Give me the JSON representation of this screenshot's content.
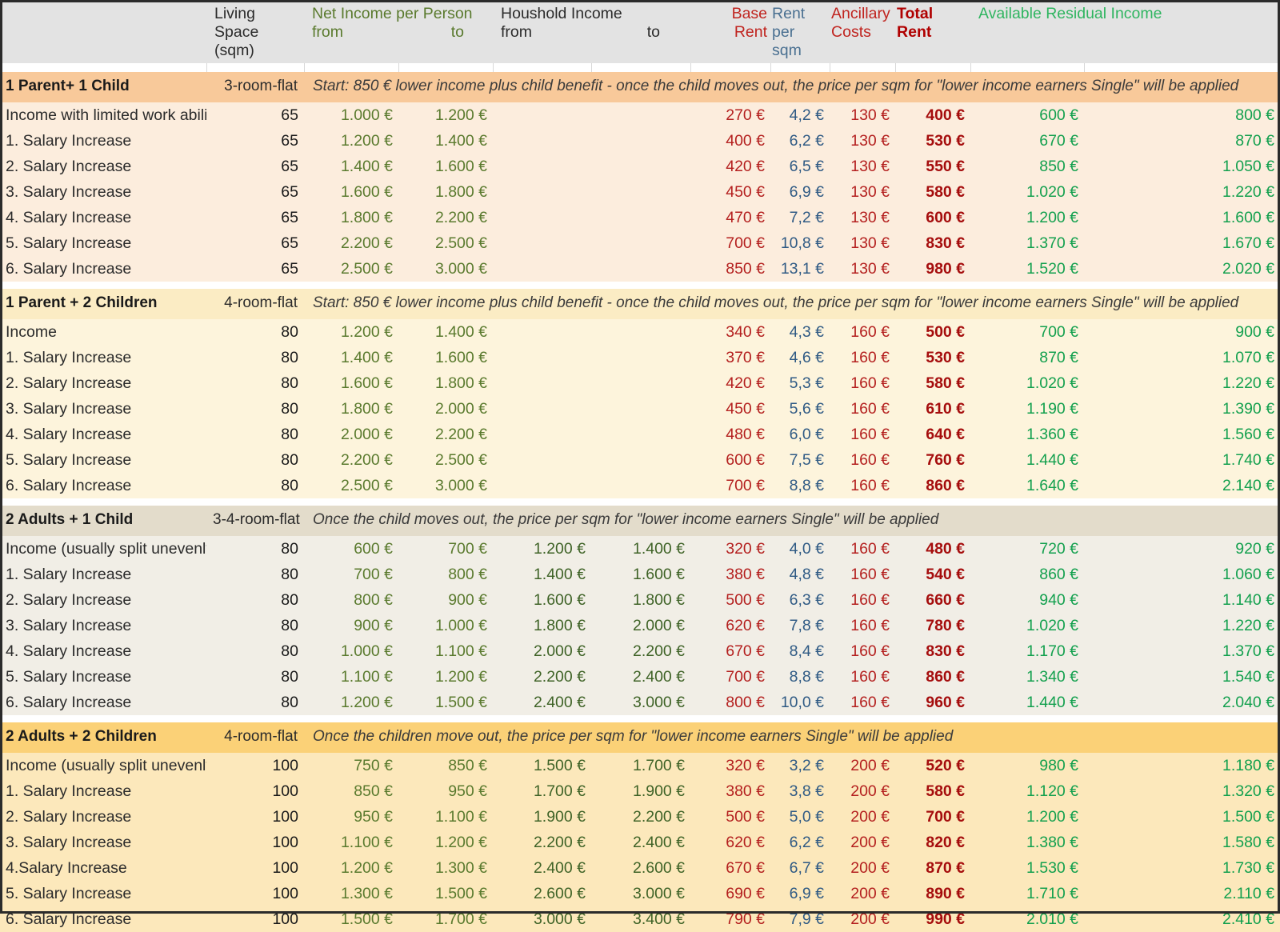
{
  "table": {
    "header": {
      "label_col": "",
      "living_space": {
        "line1": "Living Space",
        "line2": "(sqm)"
      },
      "net_income": {
        "title": "Net Income per Person",
        "from": "from",
        "to": "to"
      },
      "household_income": {
        "title": "Houshold Income",
        "from": "from",
        "to": "to"
      },
      "base_rent": "Base Rent",
      "rent_per_sqm": {
        "line1": "Rent",
        "line2": "per sqm"
      },
      "ancillary_costs": {
        "line1": "Ancillary",
        "line2": "Costs"
      },
      "total_rent": "Total Rent",
      "residual_income": "Available Residual Income"
    },
    "colors": {
      "net_income": "#5a7a2e",
      "base_rent": "#c0241f",
      "rent_per_sqm": "#4a7091",
      "ancillary": "#c0241f",
      "total_rent": "#b00000",
      "residual": "#2fb560",
      "header_bg": "#e3e3e3"
    },
    "blocks": [
      {
        "name": "1 Parent+ 1 Child",
        "flat": "3-room-flat",
        "note": "Start: 850 € lower income plus child benefit - once the child moves out, the price per sqm for \"lower income earners Single\" will be applied",
        "bg": "#fceddd",
        "header_bg": "#f8c99a",
        "rows": [
          {
            "label": "Income  with limited work ability",
            "sqm": "65",
            "net_from": "1.000 €",
            "net_to": "1.200 €",
            "hh_from": "",
            "hh_to": "",
            "base": "270 €",
            "per_sqm": "4,2 €",
            "ancillary": "130 €",
            "total": "400 €",
            "res_from": "600 €",
            "res_to": "800 €"
          },
          {
            "label": "1. Salary Increase",
            "sqm": "65",
            "net_from": "1.200 €",
            "net_to": "1.400 €",
            "hh_from": "",
            "hh_to": "",
            "base": "400 €",
            "per_sqm": "6,2 €",
            "ancillary": "130 €",
            "total": "530 €",
            "res_from": "670 €",
            "res_to": "870 €"
          },
          {
            "label": "2. Salary Increase",
            "sqm": "65",
            "net_from": "1.400 €",
            "net_to": "1.600 €",
            "hh_from": "",
            "hh_to": "",
            "base": "420 €",
            "per_sqm": "6,5 €",
            "ancillary": "130 €",
            "total": "550 €",
            "res_from": "850 €",
            "res_to": "1.050 €"
          },
          {
            "label": "3. Salary Increase",
            "sqm": "65",
            "net_from": "1.600 €",
            "net_to": "1.800 €",
            "hh_from": "",
            "hh_to": "",
            "base": "450 €",
            "per_sqm": "6,9 €",
            "ancillary": "130 €",
            "total": "580 €",
            "res_from": "1.020 €",
            "res_to": "1.220 €"
          },
          {
            "label": "4. Salary Increase",
            "sqm": "65",
            "net_from": "1.800 €",
            "net_to": "2.200 €",
            "hh_from": "",
            "hh_to": "",
            "base": "470 €",
            "per_sqm": "7,2 €",
            "ancillary": "130 €",
            "total": "600 €",
            "res_from": "1.200 €",
            "res_to": "1.600 €"
          },
          {
            "label": "5. Salary Increase",
            "sqm": "65",
            "net_from": "2.200 €",
            "net_to": "2.500 €",
            "hh_from": "",
            "hh_to": "",
            "base": "700 €",
            "per_sqm": "10,8 €",
            "ancillary": "130 €",
            "total": "830 €",
            "res_from": "1.370 €",
            "res_to": "1.670 €"
          },
          {
            "label": "6. Salary Increase",
            "sqm": "65",
            "net_from": "2.500 €",
            "net_to": "3.000 €",
            "hh_from": "",
            "hh_to": "",
            "base": "850 €",
            "per_sqm": "13,1 €",
            "ancillary": "130 €",
            "total": "980 €",
            "res_from": "1.520 €",
            "res_to": "2.020 €"
          }
        ]
      },
      {
        "name": "1 Parent + 2 Children",
        "flat": "4-room-flat",
        "note": "Start: 850 € lower income plus child benefit - once the child moves out, the price per sqm for \"lower income earners Single\" will be applied",
        "bg": "#fdf4dc",
        "header_bg": "#fbecc4",
        "rows": [
          {
            "label": "Income",
            "sqm": "80",
            "net_from": "1.200 €",
            "net_to": "1.400 €",
            "hh_from": "",
            "hh_to": "",
            "base": "340 €",
            "per_sqm": "4,3 €",
            "ancillary": "160 €",
            "total": "500 €",
            "res_from": "700 €",
            "res_to": "900 €"
          },
          {
            "label": "1. Salary Increase",
            "sqm": "80",
            "net_from": "1.400 €",
            "net_to": "1.600 €",
            "hh_from": "",
            "hh_to": "",
            "base": "370 €",
            "per_sqm": "4,6 €",
            "ancillary": "160 €",
            "total": "530 €",
            "res_from": "870 €",
            "res_to": "1.070 €"
          },
          {
            "label": "2. Salary Increase",
            "sqm": "80",
            "net_from": "1.600 €",
            "net_to": "1.800 €",
            "hh_from": "",
            "hh_to": "",
            "base": "420 €",
            "per_sqm": "5,3 €",
            "ancillary": "160 €",
            "total": "580 €",
            "res_from": "1.020 €",
            "res_to": "1.220 €"
          },
          {
            "label": "3. Salary Increase",
            "sqm": "80",
            "net_from": "1.800 €",
            "net_to": "2.000 €",
            "hh_from": "",
            "hh_to": "",
            "base": "450 €",
            "per_sqm": "5,6 €",
            "ancillary": "160 €",
            "total": "610 €",
            "res_from": "1.190 €",
            "res_to": "1.390 €"
          },
          {
            "label": "4. Salary Increase",
            "sqm": "80",
            "net_from": "2.000 €",
            "net_to": "2.200 €",
            "hh_from": "",
            "hh_to": "",
            "base": "480 €",
            "per_sqm": "6,0 €",
            "ancillary": "160 €",
            "total": "640 €",
            "res_from": "1.360 €",
            "res_to": "1.560 €"
          },
          {
            "label": "5. Salary Increase",
            "sqm": "80",
            "net_from": "2.200 €",
            "net_to": "2.500 €",
            "hh_from": "",
            "hh_to": "",
            "base": "600 €",
            "per_sqm": "7,5 €",
            "ancillary": "160 €",
            "total": "760 €",
            "res_from": "1.440 €",
            "res_to": "1.740 €"
          },
          {
            "label": "6. Salary Increase",
            "sqm": "80",
            "net_from": "2.500 €",
            "net_to": "3.000 €",
            "hh_from": "",
            "hh_to": "",
            "base": "700 €",
            "per_sqm": "8,8 €",
            "ancillary": "160 €",
            "total": "860 €",
            "res_from": "1.640 €",
            "res_to": "2.140 €"
          }
        ]
      },
      {
        "name": "2 Adults + 1 Child",
        "flat": "3-4-room-flat",
        "note": "Once the child moves out, the price per sqm for \"lower income earners Single\" will be applied",
        "bg": "#f1eee6",
        "header_bg": "#e3dccb",
        "rows": [
          {
            "label": "Income (usually split unevenly)",
            "sqm": "80",
            "net_from": "600 €",
            "net_to": "700 €",
            "hh_from": "1.200 €",
            "hh_to": "1.400 €",
            "base": "320 €",
            "per_sqm": "4,0 €",
            "ancillary": "160 €",
            "total": "480 €",
            "res_from": "720 €",
            "res_to": "920 €"
          },
          {
            "label": "1. Salary Increase",
            "sqm": "80",
            "net_from": "700 €",
            "net_to": "800 €",
            "hh_from": "1.400 €",
            "hh_to": "1.600 €",
            "base": "380 €",
            "per_sqm": "4,8 €",
            "ancillary": "160 €",
            "total": "540 €",
            "res_from": "860 €",
            "res_to": "1.060 €"
          },
          {
            "label": "2. Salary Increase",
            "sqm": "80",
            "net_from": "800 €",
            "net_to": "900 €",
            "hh_from": "1.600 €",
            "hh_to": "1.800 €",
            "base": "500 €",
            "per_sqm": "6,3 €",
            "ancillary": "160 €",
            "total": "660 €",
            "res_from": "940 €",
            "res_to": "1.140 €"
          },
          {
            "label": "3. Salary Increase",
            "sqm": "80",
            "net_from": "900 €",
            "net_to": "1.000 €",
            "hh_from": "1.800 €",
            "hh_to": "2.000 €",
            "base": "620 €",
            "per_sqm": "7,8 €",
            "ancillary": "160 €",
            "total": "780 €",
            "res_from": "1.020 €",
            "res_to": "1.220 €"
          },
          {
            "label": "4. Salary Increase",
            "sqm": "80",
            "net_from": "1.000 €",
            "net_to": "1.100 €",
            "hh_from": "2.000 €",
            "hh_to": "2.200 €",
            "base": "670 €",
            "per_sqm": "8,4 €",
            "ancillary": "160 €",
            "total": "830 €",
            "res_from": "1.170 €",
            "res_to": "1.370 €"
          },
          {
            "label": "5. Salary Increase",
            "sqm": "80",
            "net_from": "1.100 €",
            "net_to": "1.200 €",
            "hh_from": "2.200 €",
            "hh_to": "2.400 €",
            "base": "700 €",
            "per_sqm": "8,8 €",
            "ancillary": "160 €",
            "total": "860 €",
            "res_from": "1.340 €",
            "res_to": "1.540 €"
          },
          {
            "label": "6. Salary Increase",
            "sqm": "80",
            "net_from": "1.200 €",
            "net_to": "1.500 €",
            "hh_from": "2.400 €",
            "hh_to": "3.000 €",
            "base": "800 €",
            "per_sqm": "10,0 €",
            "ancillary": "160 €",
            "total": "960 €",
            "res_from": "1.440 €",
            "res_to": "2.040 €"
          }
        ]
      },
      {
        "name": "2 Adults + 2 Children",
        "flat": "4-room-flat",
        "note": "Once the children move out, the price per sqm for \"lower income earners Single\" will be applied",
        "bg": "#fce8bb",
        "header_bg": "#fbd177",
        "rows": [
          {
            "label": "Income (usually split unevenly)",
            "sqm": "100",
            "net_from": "750 €",
            "net_to": "850 €",
            "hh_from": "1.500 €",
            "hh_to": "1.700 €",
            "base": "320 €",
            "per_sqm": "3,2 €",
            "ancillary": "200 €",
            "total": "520 €",
            "res_from": "980 €",
            "res_to": "1.180 €"
          },
          {
            "label": "1. Salary Increase",
            "sqm": "100",
            "net_from": "850 €",
            "net_to": "950 €",
            "hh_from": "1.700 €",
            "hh_to": "1.900 €",
            "base": "380 €",
            "per_sqm": "3,8 €",
            "ancillary": "200 €",
            "total": "580 €",
            "res_from": "1.120 €",
            "res_to": "1.320 €"
          },
          {
            "label": "2. Salary Increase",
            "sqm": "100",
            "net_from": "950 €",
            "net_to": "1.100 €",
            "hh_from": "1.900 €",
            "hh_to": "2.200 €",
            "base": "500 €",
            "per_sqm": "5,0 €",
            "ancillary": "200 €",
            "total": "700 €",
            "res_from": "1.200 €",
            "res_to": "1.500 €"
          },
          {
            "label": "3. Salary Increase",
            "sqm": "100",
            "net_from": "1.100 €",
            "net_to": "1.200 €",
            "hh_from": "2.200 €",
            "hh_to": "2.400 €",
            "base": "620 €",
            "per_sqm": "6,2 €",
            "ancillary": "200 €",
            "total": "820 €",
            "res_from": "1.380 €",
            "res_to": "1.580 €"
          },
          {
            "label": "4.Salary Increase",
            "sqm": "100",
            "net_from": "1.200 €",
            "net_to": "1.300 €",
            "hh_from": "2.400 €",
            "hh_to": "2.600 €",
            "base": "670 €",
            "per_sqm": "6,7 €",
            "ancillary": "200 €",
            "total": "870 €",
            "res_from": "1.530 €",
            "res_to": "1.730 €"
          },
          {
            "label": "5. Salary Increase",
            "sqm": "100",
            "net_from": "1.300 €",
            "net_to": "1.500 €",
            "hh_from": "2.600 €",
            "hh_to": "3.000 €",
            "base": "690 €",
            "per_sqm": "6,9 €",
            "ancillary": "200 €",
            "total": "890 €",
            "res_from": "1.710 €",
            "res_to": "2.110 €"
          },
          {
            "label": "6. Salary Increase",
            "sqm": "100",
            "net_from": "1.500 €",
            "net_to": "1.700 €",
            "hh_from": "3.000 €",
            "hh_to": "3.400 €",
            "base": "790 €",
            "per_sqm": "7,9 €",
            "ancillary": "200 €",
            "total": "990 €",
            "res_from": "2.010 €",
            "res_to": "2.410 €"
          }
        ]
      }
    ]
  }
}
